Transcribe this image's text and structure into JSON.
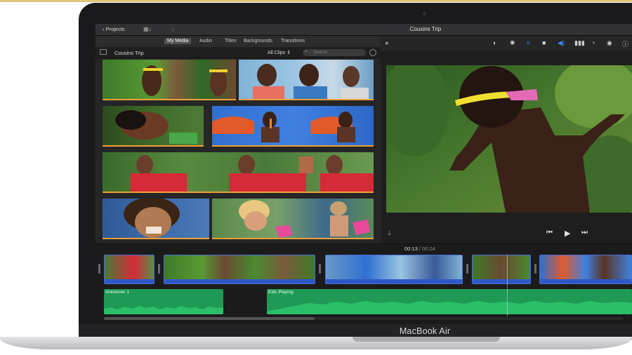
{
  "device": {
    "brand": "MacBook Air"
  },
  "toolbar": {
    "projects_label": "Projects",
    "window_title": "Cousins Trip"
  },
  "browser": {
    "tabs": [
      {
        "label": "My Media",
        "active": true
      },
      {
        "label": "Audio",
        "active": false
      },
      {
        "label": "Titles",
        "active": false
      },
      {
        "label": "Backgrounds",
        "active": false
      },
      {
        "label": "Transitions",
        "active": false
      }
    ],
    "library_name": "Cousins Trip",
    "filter": "All Clips",
    "search_placeholder": "Search"
  },
  "viewer": {
    "tools": [
      "color-balance-icon",
      "color-correction-icon",
      "crop-icon",
      "stabilization-icon",
      "volume-icon",
      "noise-reduction-icon",
      "speed-icon",
      "clip-filter-icon",
      "info-icon"
    ]
  },
  "timeline": {
    "current_time": "00:13",
    "separator": "/",
    "total_time": "00:24",
    "audio_tracks": [
      {
        "label": "Voiceover 1"
      },
      {
        "label": "Kids Playing"
      }
    ]
  },
  "colors": {
    "accent_orange": "#f0a03a",
    "timeline_blue": "#2f59c5",
    "audio_green": "#1f9a55",
    "selected_blue": "#3d8bff"
  }
}
